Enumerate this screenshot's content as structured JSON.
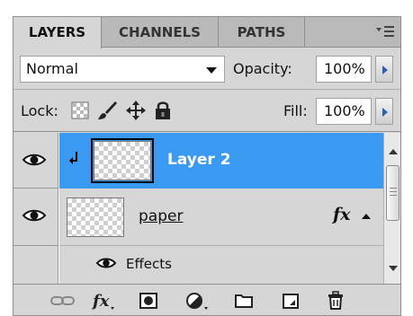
{
  "tabs": [
    {
      "label": "LAYERS",
      "active": true
    },
    {
      "label": "CHANNELS",
      "active": false
    },
    {
      "label": "PATHS",
      "active": false
    }
  ],
  "panel_menu_icon": "panel-menu-icon",
  "blend": {
    "mode": "Normal",
    "opacity_label": "Opacity:",
    "opacity_value": "100%"
  },
  "lock": {
    "label": "Lock:",
    "fill_label": "Fill:",
    "fill_value": "100%"
  },
  "layers": [
    {
      "name": "Layer 2",
      "selected": true,
      "visible": true,
      "clipped": true
    },
    {
      "name": "paper",
      "selected": false,
      "visible": true,
      "fx_label": "fx"
    }
  ],
  "effects": {
    "label": "Effects",
    "visible": true
  },
  "bottom_tools": [
    "link-layers-icon",
    "layer-style-icon",
    "layer-mask-icon",
    "adjustment-layer-icon",
    "new-group-icon",
    "new-layer-icon",
    "delete-layer-icon"
  ],
  "colors": {
    "selection": "#3a99f0",
    "panel": "#d6d6d6"
  }
}
